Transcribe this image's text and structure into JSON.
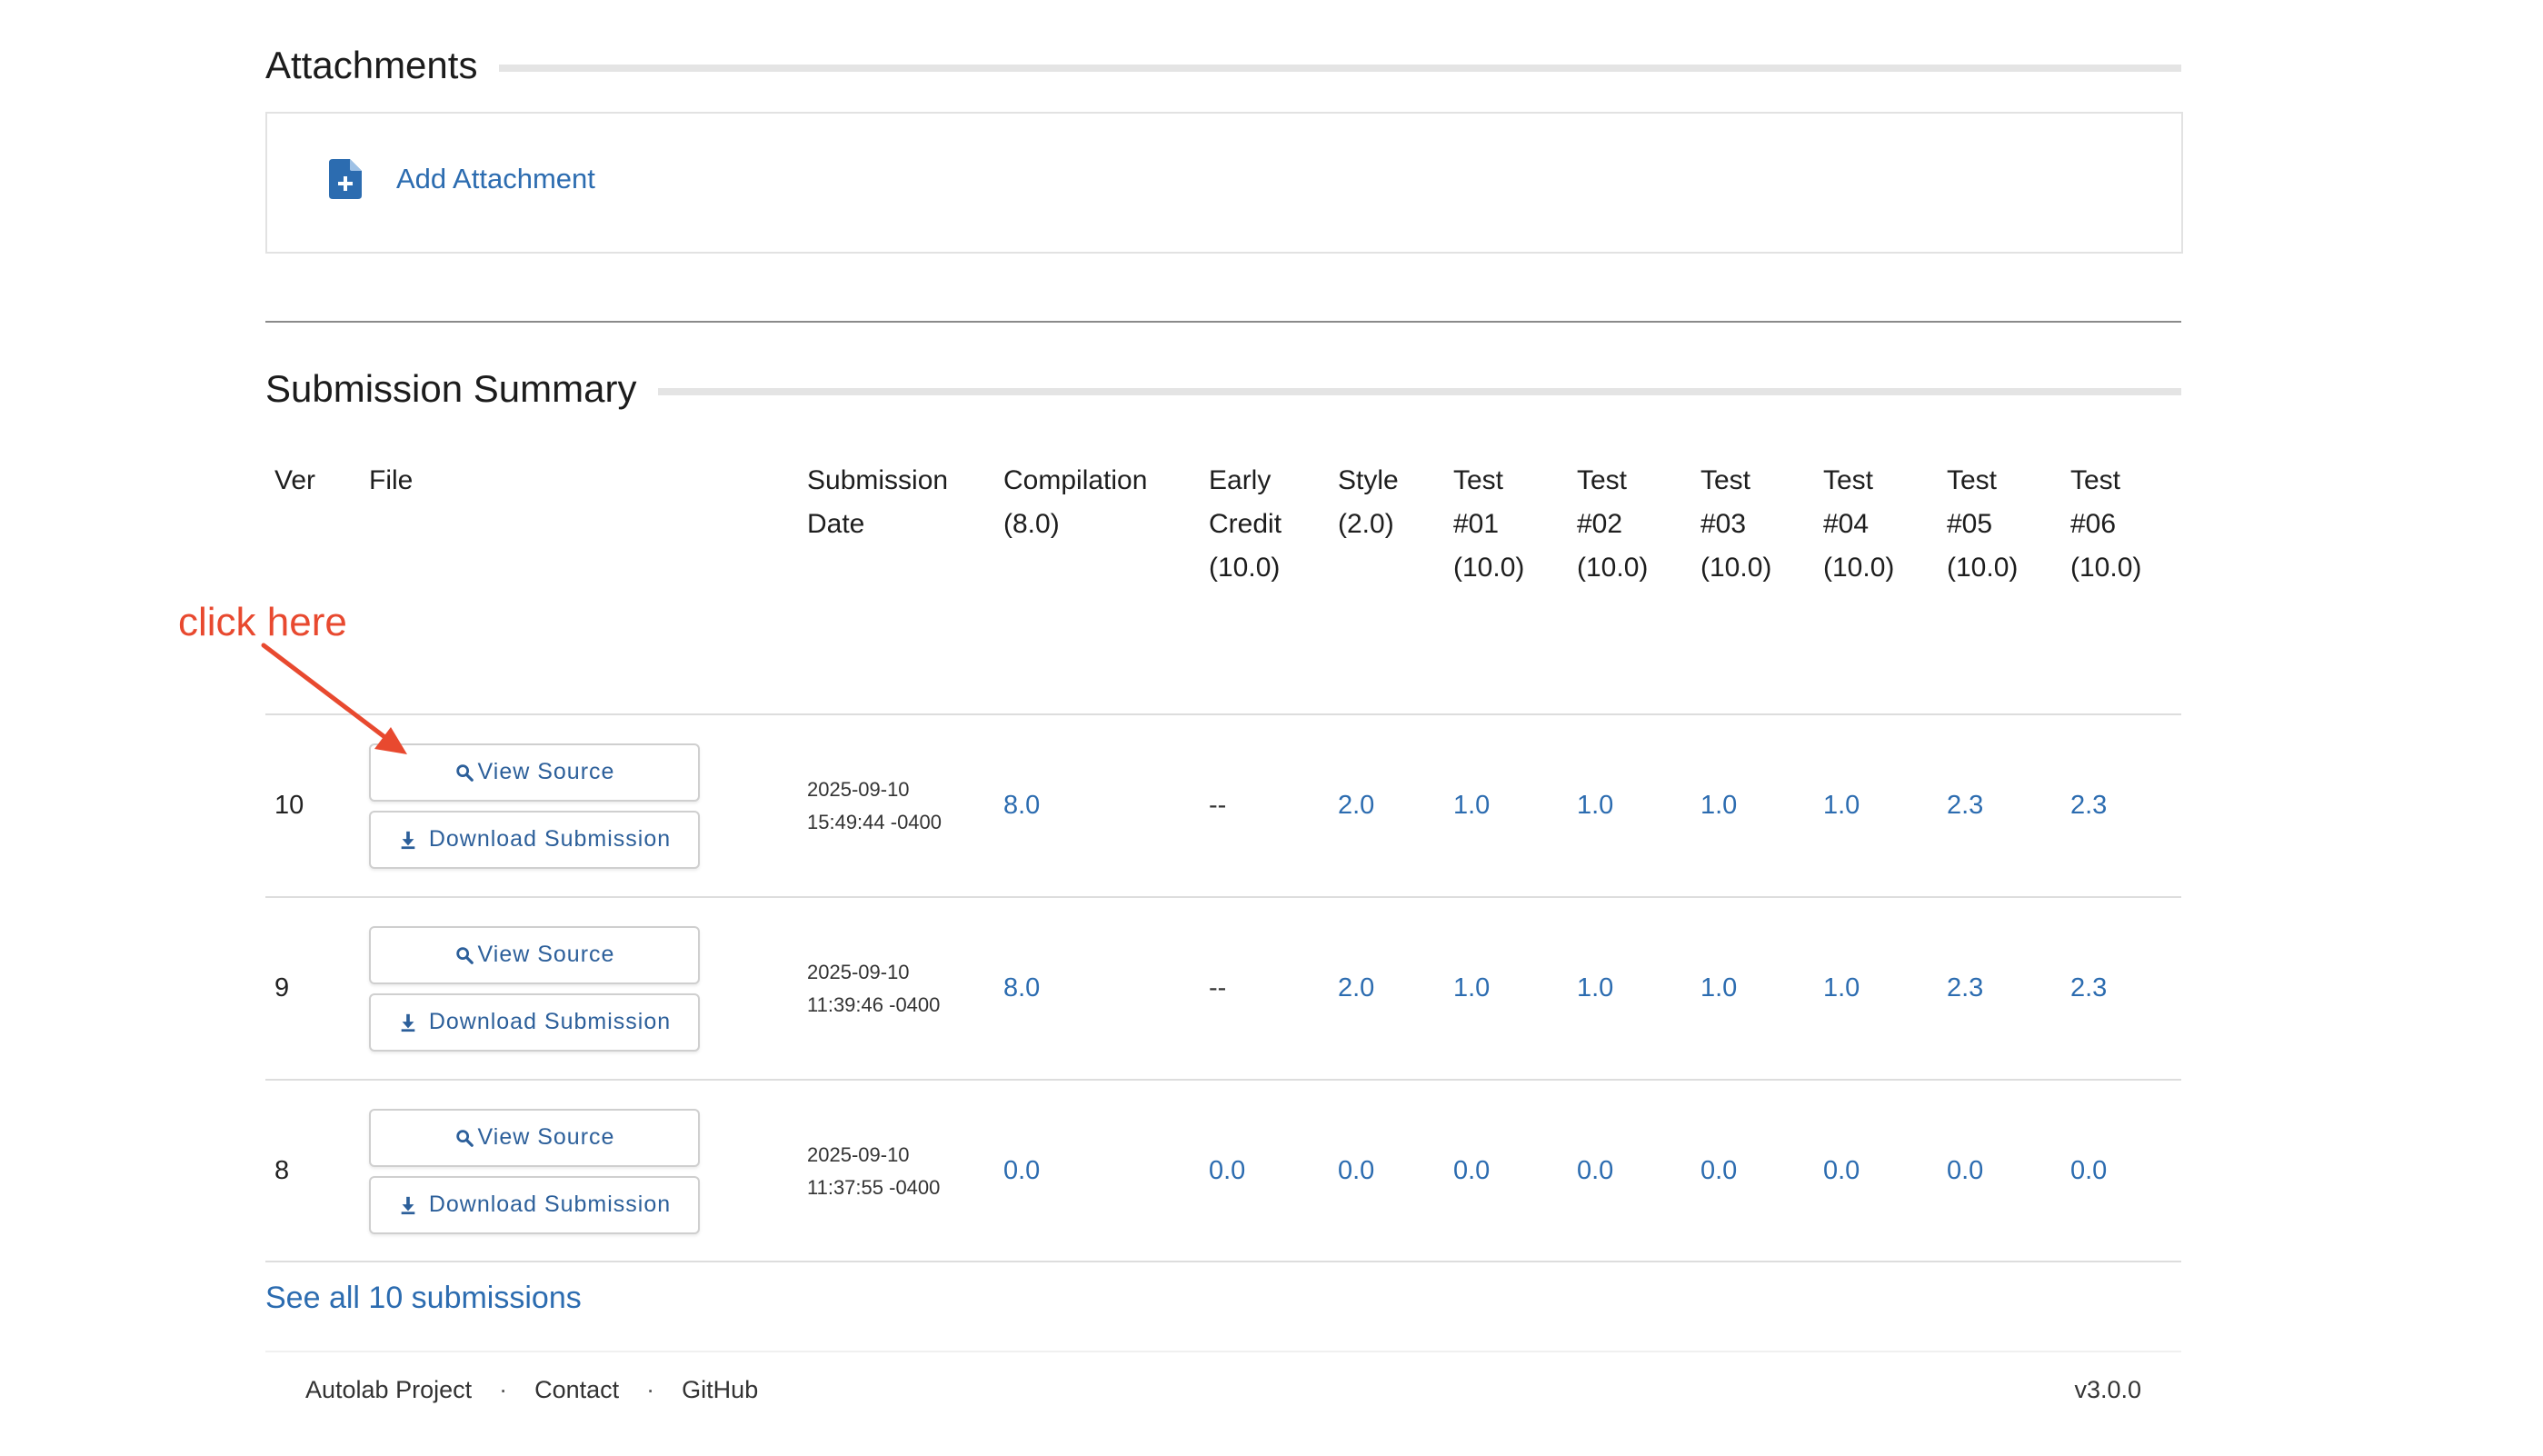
{
  "attachments": {
    "title": "Attachments",
    "add_label": "Add Attachment"
  },
  "summary": {
    "title": "Submission Summary",
    "headers": [
      [
        "Ver"
      ],
      [
        "File"
      ],
      [
        "Submission",
        "Date"
      ],
      [
        "Compilation",
        "(8.0)"
      ],
      [
        "Early",
        "Credit",
        "(10.0)"
      ],
      [
        "Style",
        "(2.0)"
      ],
      [
        "Test",
        "#01",
        "(10.0)"
      ],
      [
        "Test",
        "#02",
        "(10.0)"
      ],
      [
        "Test",
        "#03",
        "(10.0)"
      ],
      [
        "Test",
        "#04",
        "(10.0)"
      ],
      [
        "Test",
        "#05",
        "(10.0)"
      ],
      [
        "Test",
        "#06",
        "(10.0)"
      ]
    ],
    "rows": [
      {
        "ver": "10",
        "view_label": "View Source",
        "download_label": "Download Submission",
        "date": "2025-09-10",
        "time": "15:49:44 -0400",
        "scores": [
          "8.0",
          "--",
          "2.0",
          "1.0",
          "1.0",
          "1.0",
          "1.0",
          "2.3",
          "2.3"
        ]
      },
      {
        "ver": "9",
        "view_label": "View Source",
        "download_label": "Download Submission",
        "date": "2025-09-10",
        "time": "11:39:46 -0400",
        "scores": [
          "8.0",
          "--",
          "2.0",
          "1.0",
          "1.0",
          "1.0",
          "1.0",
          "2.3",
          "2.3"
        ]
      },
      {
        "ver": "8",
        "view_label": "View Source",
        "download_label": "Download Submission",
        "date": "2025-09-10",
        "time": "11:37:55 -0400",
        "scores": [
          "0.0",
          "0.0",
          "0.0",
          "0.0",
          "0.0",
          "0.0",
          "0.0",
          "0.0",
          "0.0"
        ]
      }
    ],
    "see_all": "See all 10 submissions"
  },
  "annotation": {
    "text": "click here",
    "color": "#e8492f"
  },
  "footer": {
    "links": [
      "Autolab Project",
      "Contact",
      "GitHub"
    ],
    "separator": "·",
    "version": "v3.0.0"
  },
  "icons": {
    "attachment": "file-plus-icon",
    "view": "magnifier-icon",
    "download": "download-icon"
  },
  "colors": {
    "link": "#2c6cb0",
    "button_text": "#2c5f9a"
  }
}
